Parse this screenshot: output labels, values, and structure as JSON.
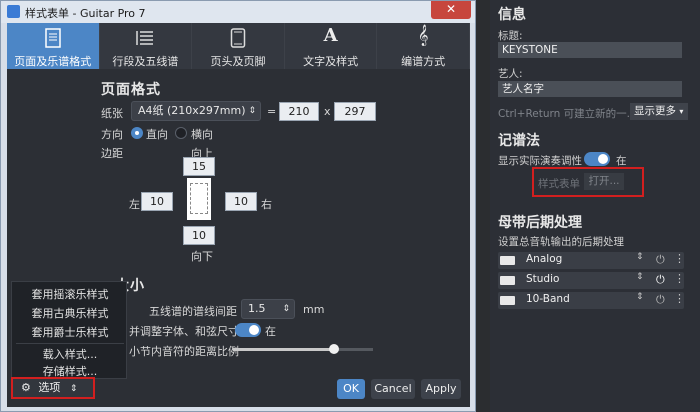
{
  "window": {
    "title": "样式表单 - Guitar Pro 7",
    "close": "✕"
  },
  "tabs": [
    {
      "label": "页面及乐谱格式",
      "icon": "page-icon"
    },
    {
      "label": "行段及五线谱",
      "icon": "lines-icon"
    },
    {
      "label": "页头及页脚",
      "icon": "tablet-icon"
    },
    {
      "label": "文字及样式",
      "icon": "letter-a-icon"
    },
    {
      "label": "编谱方式",
      "icon": "treble-clef-icon"
    }
  ],
  "page_format": {
    "heading": "页面格式",
    "paper_label": "纸张",
    "paper_value": "A4纸 (210x297mm)",
    "equals": "=",
    "width": "210",
    "times": "x",
    "height": "297",
    "orientation_label": "方向",
    "portrait": "直向",
    "landscape": "横向",
    "margins_label": "边距",
    "top_label": "向上",
    "top": "15",
    "left_label": "左",
    "left": "10",
    "right": "10",
    "right_label": "右",
    "bottom": "10",
    "bottom_label": "向下"
  },
  "size": {
    "heading": "大小",
    "staff_spacing_label": "五线谱的谱线间距",
    "staff_spacing_value": "1.5",
    "unit": "mm",
    "scale_label": "并调整字体、和弦尺寸",
    "scale_state": "在",
    "ratio_label": "小节内音符的距离比例",
    "slider_fraction": 0.72
  },
  "menu": {
    "items": [
      "套用摇滚乐样式",
      "套用古典乐样式",
      "套用爵士乐样式",
      "载入样式...",
      "存储样式..."
    ]
  },
  "footer": {
    "options_label": "选项",
    "ok": "OK",
    "cancel": "Cancel",
    "apply": "Apply"
  },
  "right_panel": {
    "info_heading": "信息",
    "title_label": "标题:",
    "title_value": "KEYSTONE",
    "artist_label": "艺人:",
    "artist_value": "艺人名字",
    "hint": "Ctrl+Return 可建立新的一...",
    "show_more": "显示更多",
    "notation_heading": "记谱法",
    "transpose_label": "显示实际演奏调性",
    "transpose_state": "在",
    "stylesheet_label": "样式表单",
    "open_button": "打开...",
    "master_heading": "母带后期处理",
    "master_desc": "设置总音轨输出的后期处理",
    "effects": [
      {
        "name": "Analog",
        "active": false
      },
      {
        "name": "Studio",
        "active": true
      },
      {
        "name": "10-Band",
        "active": false
      }
    ]
  },
  "colors": {
    "accent": "#4c86c6",
    "highlight_box": "#d21f1f"
  }
}
